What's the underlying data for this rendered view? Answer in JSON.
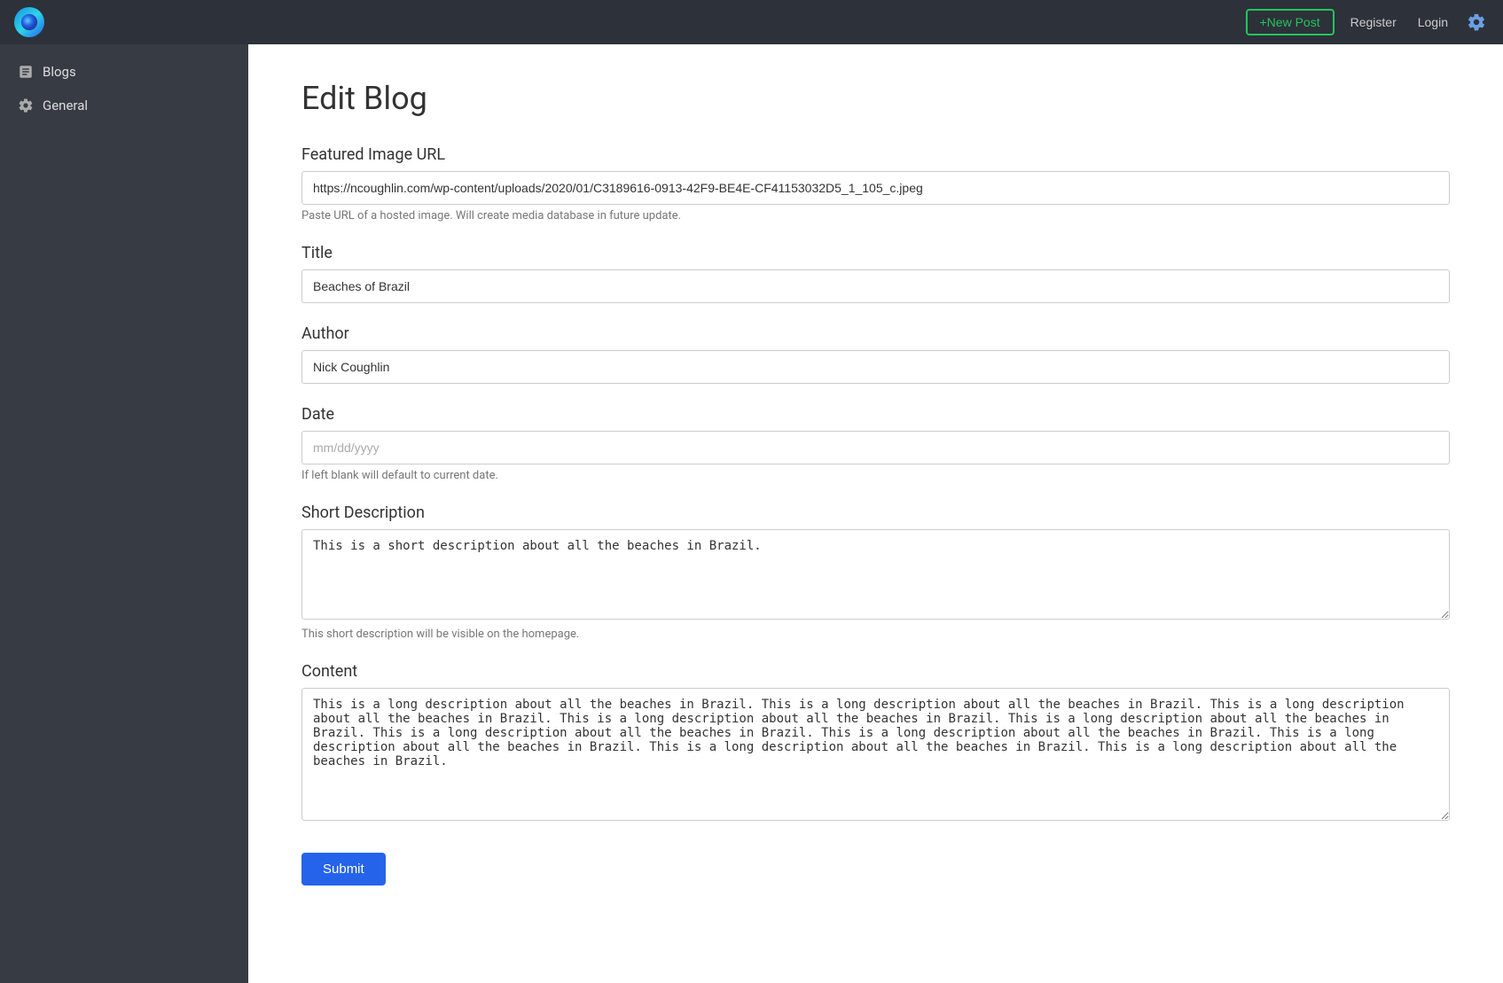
{
  "topnav": {
    "new_post_label": "+New Post",
    "register_label": "Register",
    "login_label": "Login"
  },
  "sidebar": {
    "items": [
      {
        "id": "blogs",
        "label": "Blogs",
        "icon": "blogs-icon"
      },
      {
        "id": "general",
        "label": "General",
        "icon": "gear-icon"
      }
    ]
  },
  "page": {
    "title": "Edit Blog",
    "fields": {
      "featured_image": {
        "label": "Featured Image URL",
        "value": "https://ncoughlin.com/wp-content/uploads/2020/01/C3189616-0913-42F9-BE4E-CF41153032D5_1_105_c.jpeg",
        "hint": "Paste URL of a hosted image. Will create media database in future update."
      },
      "title": {
        "label": "Title",
        "value": "Beaches of Brazil"
      },
      "author": {
        "label": "Author",
        "value": "Nick Coughlin"
      },
      "date": {
        "label": "Date",
        "placeholder": "mm/dd/yyyy",
        "hint": "If left blank will default to current date."
      },
      "short_description": {
        "label": "Short Description",
        "value": "This is a short description about all the beaches in Brazil.",
        "hint": "This short description will be visible on the homepage."
      },
      "content": {
        "label": "Content",
        "value": "This is a long description about all the beaches in Brazil. This is a long description about all the beaches in Brazil. This is a long description about all the beaches in Brazil. This is a long description about all the beaches in Brazil. This is a long description about all the beaches in Brazil. This is a long description about all the beaches in Brazil. This is a long description about all the beaches in Brazil. This is a long description about all the beaches in Brazil. This is a long description about all the beaches in Brazil. This is a long description about all the beaches in Brazil."
      }
    },
    "submit_label": "Submit"
  }
}
